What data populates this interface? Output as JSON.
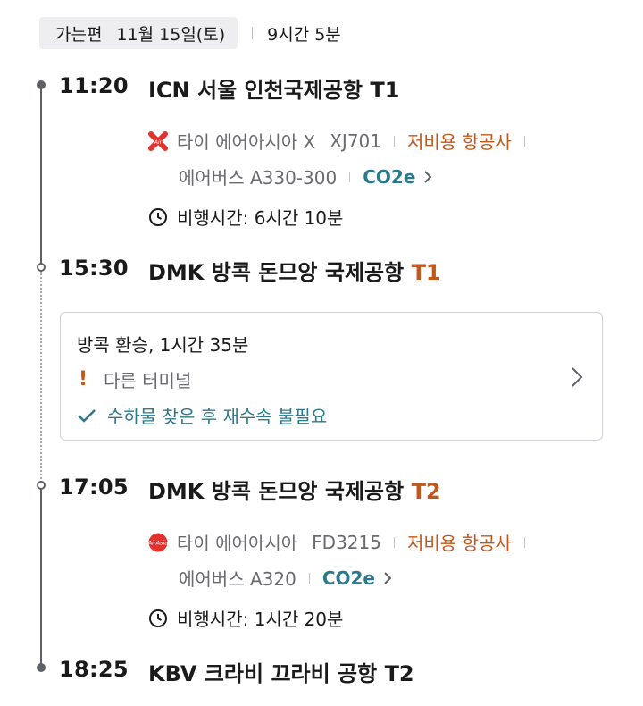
{
  "header": {
    "direction_label": "가는편",
    "date": "11월 15일(토)",
    "total_duration": "9시간 5분"
  },
  "segments": [
    {
      "departure": {
        "time": "11:20",
        "airport": "ICN 서울 인천국제공항",
        "terminal": "T1",
        "terminal_color": "#1a1a1a"
      },
      "airline": {
        "name": "타이 에어아시아 X",
        "flight_number": "XJ701",
        "carrier_type": "저비용 항공사",
        "logo_icon": "airasia-x-logo-icon"
      },
      "aircraft": {
        "model": "에어버스 A330-300",
        "co2_label": "CO2e"
      },
      "flight_time": "비행시간: 6시간 10분",
      "arrival": {
        "time": "15:30",
        "airport": "DMK 방콕 돈므앙 국제공항",
        "terminal": "T1",
        "terminal_color": "#c2571a"
      }
    },
    {
      "departure": {
        "time": "17:05",
        "airport": "DMK 방콕 돈므앙 국제공항",
        "terminal": "T2",
        "terminal_color": "#c2571a"
      },
      "airline": {
        "name": "타이 에어아시아",
        "flight_number": "FD3215",
        "carrier_type": "저비용 항공사",
        "logo_icon": "airasia-logo-icon"
      },
      "aircraft": {
        "model": "에어버스 A320",
        "co2_label": "CO2e"
      },
      "flight_time": "비행시간: 1시간 20분",
      "arrival": {
        "time": "18:25",
        "airport": "KBV 크라비 끄라비 공항",
        "terminal": "T2",
        "terminal_color": "#1a1a1a"
      }
    }
  ],
  "transfer": {
    "title": "방콕 환승, 1시간 35분",
    "warning": "다른 터미널",
    "baggage_note": "수하물 찾은 후 재수속 불필요"
  },
  "colors": {
    "accent_orange": "#c2571a",
    "accent_teal": "#2b7a8c",
    "timeline": "#5e6067"
  }
}
